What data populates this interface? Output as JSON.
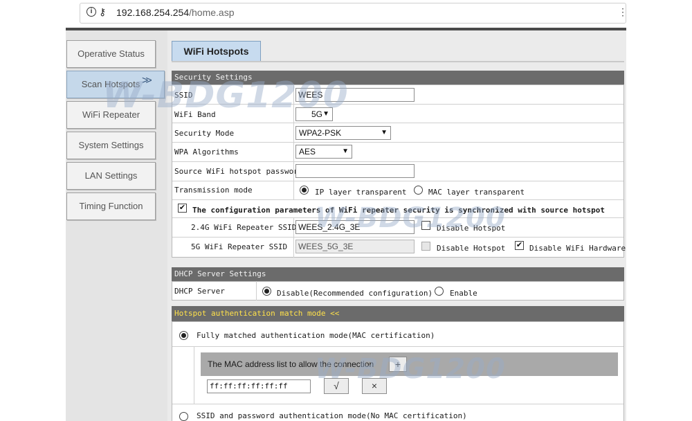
{
  "browser": {
    "url_host": "192.168.254.254",
    "url_path": "/home.asp",
    "icons": [
      "info-icon",
      "key-icon",
      "more-icon"
    ]
  },
  "sidebar": {
    "items": [
      {
        "label": "Operative Status"
      },
      {
        "label": "Scan Hotspots",
        "active": true
      },
      {
        "label": "WiFi Repeater"
      },
      {
        "label": "System Settings"
      },
      {
        "label": "LAN Settings"
      },
      {
        "label": "Timing Function"
      }
    ],
    "active_arrow": ">>"
  },
  "page_tab": "WiFi Hotspots",
  "security": {
    "header": "Security Settings",
    "ssid_label": "SSID",
    "ssid_value": "WEES",
    "band_label": "WiFi Band",
    "band_value": "5G",
    "mode_label": "Security Mode",
    "mode_value": "WPA2-PSK",
    "wpa_label": "WPA Algorithms",
    "wpa_value": "AES",
    "pwd_label": "Source WiFi hotspot password",
    "pwd_value": "",
    "trans_label": "Transmission mode",
    "trans_opt1": "IP layer transparent",
    "trans_opt2": "MAC layer transparent",
    "trans_selected": "IP layer transparent",
    "sync_label": "The configuration parameters of WiFi repeater security is synchronized with source hotspot",
    "sync_checked": true,
    "rep24_label": "2.4G WiFi Repeater SSID",
    "rep24_value": "WEES_2.4G_3E",
    "rep24_disable_label": "Disable Hotspot",
    "rep24_disable_checked": false,
    "rep5_label": "5G WiFi Repeater SSID",
    "rep5_value": "WEES_5G_3E",
    "rep5_disable_label": "Disable Hotspot",
    "rep5_disable_checked": false,
    "rep5_hw_label": "Disable WiFi Hardware",
    "rep5_hw_checked": true
  },
  "dhcp": {
    "header": "DHCP Server Settings",
    "label": "DHCP Server",
    "opt_disable": "Disable(Recommended configuration)",
    "opt_enable": "Enable",
    "selected": "Disable(Recommended configuration)"
  },
  "auth": {
    "header": "Hotspot authentication match mode <<",
    "mode1": "Fully matched authentication mode(MAC certification)",
    "mode1_selected": true,
    "mac_list_title": "The MAC address list to allow the connection",
    "add_label": "+",
    "mac_value": "ff:ff:ff:ff:ff:ff",
    "confirm_label": "√",
    "delete_label": "×",
    "mode2": "SSID and password authentication mode(No MAC certification)",
    "mode2_selected": false
  },
  "watermark": "W-BDG1200",
  "colors": {
    "section_header": "#6b6b6b",
    "auth_header_text": "#ffe14a",
    "active_nav": "#c5d8ea",
    "tab": "#c7dbef"
  }
}
